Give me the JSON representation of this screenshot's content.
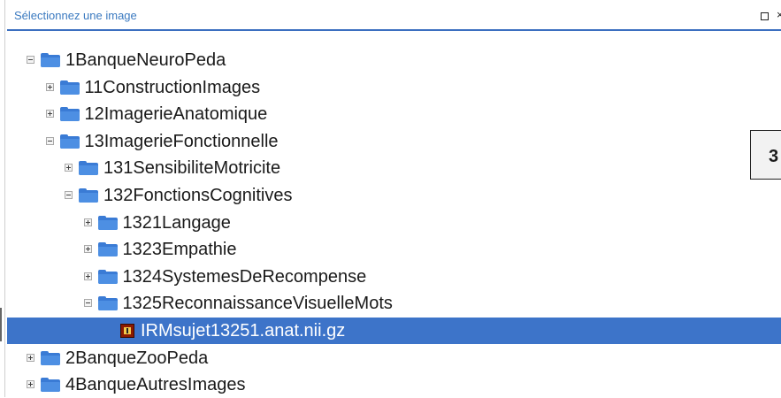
{
  "window": {
    "title": "Sélectionnez une image",
    "maximize_label": "",
    "close_label": "×"
  },
  "badge_text": "3",
  "tree": {
    "nodes": [
      {
        "label": "1BanqueNeuroPeda",
        "depth": 0,
        "state": "expanded",
        "kind": "folder"
      },
      {
        "label": "11ConstructionImages",
        "depth": 1,
        "state": "collapsed",
        "kind": "folder"
      },
      {
        "label": "12ImagerieAnatomique",
        "depth": 1,
        "state": "collapsed",
        "kind": "folder"
      },
      {
        "label": "13ImagerieFonctionnelle",
        "depth": 1,
        "state": "expanded",
        "kind": "folder"
      },
      {
        "label": "131SensibiliteMotricite",
        "depth": 2,
        "state": "collapsed",
        "kind": "folder"
      },
      {
        "label": "132FonctionsCognitives",
        "depth": 2,
        "state": "expanded",
        "kind": "folder"
      },
      {
        "label": "1321Langage",
        "depth": 3,
        "state": "collapsed",
        "kind": "folder"
      },
      {
        "label": "1323Empathie",
        "depth": 3,
        "state": "collapsed",
        "kind": "folder"
      },
      {
        "label": "1324SystemesDeRecompense",
        "depth": 3,
        "state": "collapsed",
        "kind": "folder"
      },
      {
        "label": "1325ReconnaissanceVisuelleMots",
        "depth": 3,
        "state": "expanded",
        "kind": "folder"
      },
      {
        "label": "IRMsujet13251.anat.nii.gz",
        "depth": 4,
        "state": "leaf",
        "kind": "file",
        "selected": true
      },
      {
        "label": "2BanqueZooPeda",
        "depth": 0,
        "state": "collapsed",
        "kind": "folder"
      },
      {
        "label": "4BanqueAutresImages",
        "depth": 0,
        "state": "collapsed",
        "kind": "folder"
      }
    ]
  },
  "colors": {
    "title_text": "#3b7ac0",
    "title_underline": "#3b6fc0",
    "selection": "#3d74c9",
    "folder": "#3a7bd5"
  },
  "icons": {
    "folder": "folder-icon",
    "file": "nifti-image-file-icon",
    "expanded": "minus-box-icon",
    "collapsed": "plus-box-icon"
  }
}
